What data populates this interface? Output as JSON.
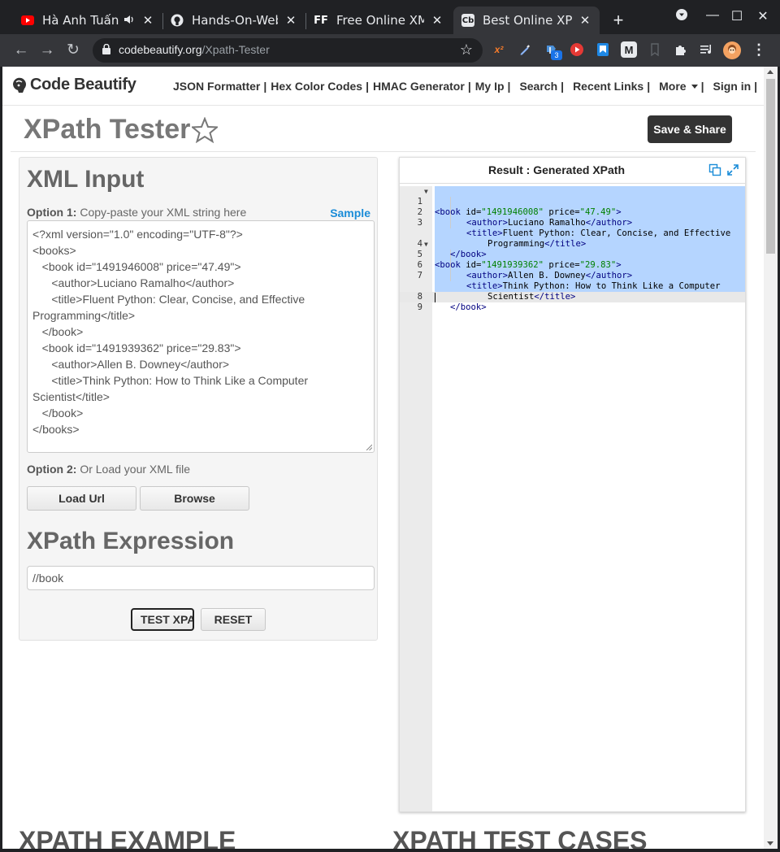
{
  "browser": {
    "tabs": [
      {
        "title": "Hà Anh Tuấn",
        "favicon": "youtube-icon",
        "favicon_color": "#ff0000",
        "audio": true
      },
      {
        "title": "Hands-On-Web-S",
        "favicon": "github-icon",
        "favicon_color": "#ffffff"
      },
      {
        "title": "Free Online XML",
        "favicon": "ff-icon",
        "favicon_text": "FF",
        "favicon_color": "#ffffff"
      },
      {
        "title": "Best Online XPat",
        "favicon": "codebeautify-icon",
        "favicon_text": "Cb",
        "favicon_color": "#ffffff",
        "active": true
      }
    ],
    "url_host": "codebeautify.org",
    "url_path": "/Xpath-Tester",
    "extension_badge": "3"
  },
  "site": {
    "logo_text": "Code Beautify",
    "nav": [
      {
        "label": "JSON Formatter",
        "sep": "|"
      },
      {
        "label": "Hex Color Codes",
        "sep": "|"
      },
      {
        "label": "HMAC Generator",
        "sep": "|"
      },
      {
        "label": "My Ip",
        "sep": "|"
      },
      {
        "label": "Search",
        "sep": "|"
      },
      {
        "label": "Recent Links",
        "sep": "|"
      },
      {
        "label": "More",
        "sep": "|",
        "dropdown": true
      },
      {
        "label": "Sign in",
        "sep": "|"
      }
    ]
  },
  "page": {
    "title": "XPath Tester",
    "save_share": "Save & Share"
  },
  "input": {
    "heading": "XML Input",
    "option1_label": "Option 1:",
    "option1_text": "Copy-paste your XML string here",
    "sample_link": "Sample",
    "xml_lines": [
      "<?xml version=\"1.0\" encoding=\"UTF-8\"?>",
      "<books>",
      "   <book id=\"1491946008\" price=\"47.49\">",
      "      <author>Luciano Ramalho</author>",
      "      <title>Fluent Python: Clear, Concise, and Effective Programming</title>",
      "   </book>",
      "   <book id=\"1491939362\" price=\"29.83\">",
      "      <author>Allen B. Downey</author>",
      "      <title>Think Python: How to Think Like a Computer Scientist</title>",
      "   </book>",
      "</books>"
    ],
    "option2_label": "Option 2:",
    "option2_text": "Or Load your XML file",
    "load_url": "Load Url",
    "browse": "Browse",
    "xpath_heading": "XPath Expression",
    "xpath_value": "//book",
    "test_button": "TEST XPATH",
    "reset_button": "RESET"
  },
  "result": {
    "title": "Result : Generated XPath",
    "line_numbers": [
      "1",
      "2",
      "3",
      "",
      "4",
      "5",
      "6",
      "7",
      "",
      "8",
      "9"
    ],
    "tokens": {
      "book_open": "<book",
      "book_close": "</book>",
      "author_open": "<author>",
      "author_close": "</author>",
      "title_open": "<title>",
      "title_close": "</title>",
      "gt": ">",
      "attr_id": "id=",
      "attr_price": "price=",
      "id1": "\"1491946008\"",
      "price1": "\"47.49\"",
      "author1": "Luciano Ramalho",
      "title1a": "Fluent Python: Clear, Concise, and Effective",
      "title1b": "Programming",
      "id2": "\"1491939362\"",
      "price2": "\"29.83\"",
      "author2": "Allen B. Downey",
      "title2a": "Think Python: How to Think Like a Computer",
      "title2b": "Scientist"
    }
  },
  "below_fold": {
    "left_heading": "XPATH EXAMPLE",
    "right_heading": "XPATH TEST CASES"
  }
}
